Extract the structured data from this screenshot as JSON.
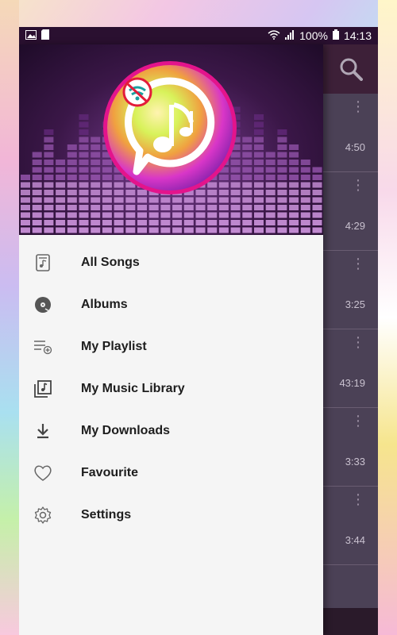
{
  "status_bar": {
    "battery": "100%",
    "time": "14:13"
  },
  "drawer": {
    "items": [
      {
        "label": "All Songs",
        "icon": "music-file-icon"
      },
      {
        "label": "Albums",
        "icon": "album-icon"
      },
      {
        "label": "My Playlist",
        "icon": "playlist-add-icon"
      },
      {
        "label": "My Music Library",
        "icon": "music-library-icon"
      },
      {
        "label": "My Downloads",
        "icon": "download-icon"
      },
      {
        "label": "Favourite",
        "icon": "heart-icon"
      },
      {
        "label": "Settings",
        "icon": "gear-icon"
      }
    ]
  },
  "songs": [
    {
      "duration": "4:50"
    },
    {
      "duration": "4:29"
    },
    {
      "duration": "3:25"
    },
    {
      "duration": "43:19"
    },
    {
      "duration": "3:33"
    },
    {
      "duration": "3:44"
    }
  ],
  "colors": {
    "status_bar": "#2a1030",
    "drawer_bg": "#f5f5f5",
    "header_purple": "#7b3f94",
    "logo_pink": "#e3148c"
  }
}
